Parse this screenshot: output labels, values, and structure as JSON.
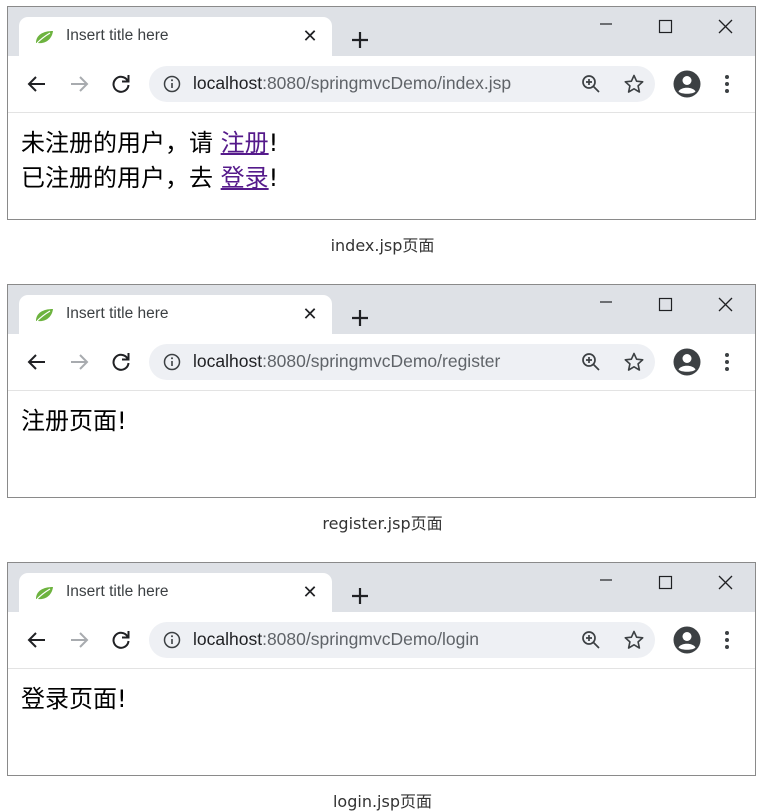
{
  "windows": [
    {
      "tab_title": "Insert title here",
      "url_host": "localhost",
      "url_rest": ":8080/springmvcDemo/index.jsp",
      "lines": [
        {
          "prefix": "未注册的用户，请 ",
          "link": "注册",
          "suffix": "!"
        },
        {
          "prefix": "已注册的用户，去 ",
          "link": "登录",
          "suffix": "!"
        }
      ],
      "caption": "index.jsp页面"
    },
    {
      "tab_title": "Insert title here",
      "url_host": "localhost",
      "url_rest": ":8080/springmvcDemo/register",
      "body_text": "注册页面!",
      "caption": "register.jsp页面"
    },
    {
      "tab_title": "Insert title here",
      "url_host": "localhost",
      "url_rest": ":8080/springmvcDemo/login",
      "body_text": "登录页面!",
      "caption": "login.jsp页面"
    }
  ],
  "icons": {
    "tab_favicon": "spring-leaf-icon",
    "tab_close": "close-icon",
    "new_tab": "plus-icon",
    "minimize": "minimize-icon",
    "maximize": "maximize-icon",
    "window_close": "close-icon",
    "back": "back-arrow-icon",
    "forward": "forward-arrow-icon",
    "reload": "reload-icon",
    "site_info": "info-icon",
    "zoom": "zoom-icon",
    "bookmark": "star-icon",
    "profile": "profile-icon",
    "menu": "kebab-menu-icon"
  },
  "colors": {
    "titlebar": "#dee1e6",
    "omnibox": "#eef0f4",
    "link_visited": "#551a8b",
    "leaf": "#6db33f"
  }
}
